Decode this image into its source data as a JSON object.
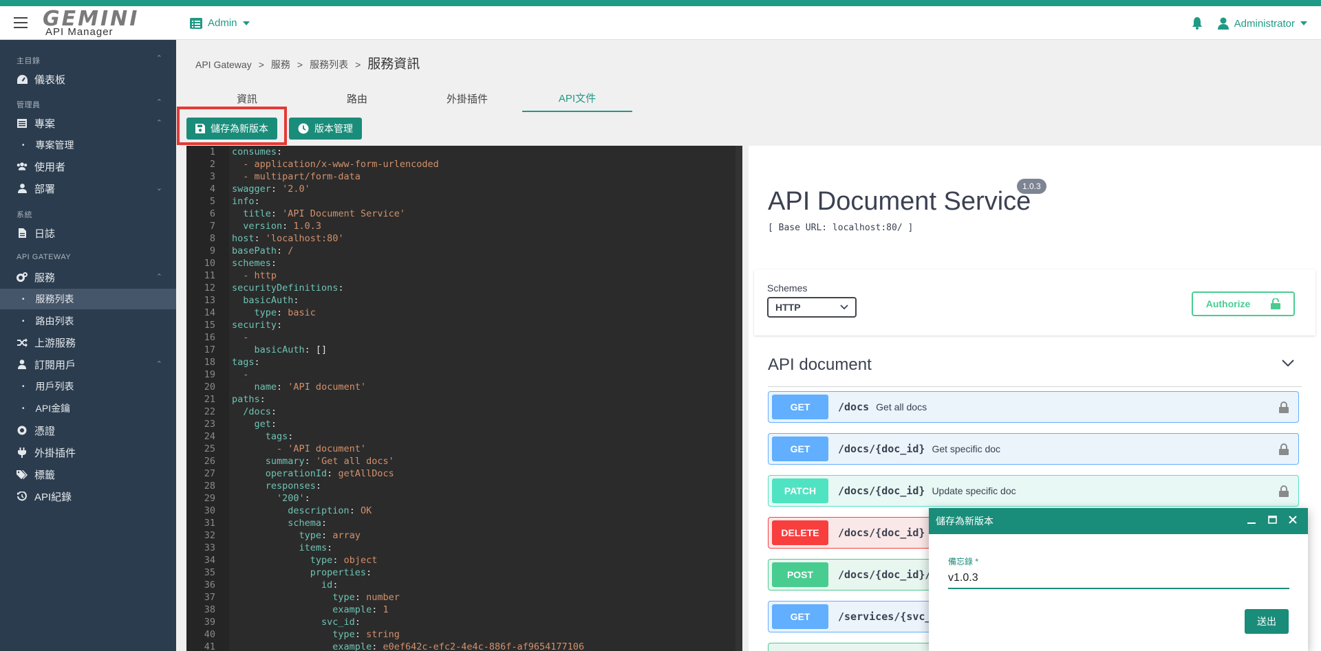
{
  "app": {
    "logo_main": "GEMINI",
    "logo_sub": "API Manager",
    "role_menu": "Admin",
    "user_name": "Administrator"
  },
  "sidebar": {
    "sections": {
      "main": "主目錄",
      "admin": "管理員",
      "system": "系統",
      "gateway": "API GATEWAY"
    },
    "items": {
      "dashboard": "儀表板",
      "projects": "專案",
      "project_mgmt": "專案管理",
      "users": "使用者",
      "departments": "部署",
      "logs": "日誌",
      "services": "服務",
      "service_list": "服務列表",
      "route_list": "路由列表",
      "upstream": "上游服務",
      "subscribers": "訂閱用戶",
      "user_list": "用戶列表",
      "api_keys": "API金鑰",
      "certs": "憑證",
      "plugins": "外掛插件",
      "tags": "標籤",
      "api_records": "API紀錄"
    }
  },
  "breadcrumb": {
    "root": "API Gateway",
    "sep": ">",
    "level1": "服務",
    "level2": "服務列表",
    "current": "服務資訊"
  },
  "tabs": [
    "資訊",
    "路由",
    "外掛插件",
    "API文件"
  ],
  "toolbar": {
    "save_new_version": "儲存為新版本",
    "version_mgmt": "版本管理"
  },
  "editor": {
    "lines": [
      [
        {
          "t": "consumes",
          "c": "k"
        },
        {
          "t": ":",
          "c": "p"
        }
      ],
      [
        {
          "t": "  - application/x-www-form-urlencoded",
          "c": "s"
        }
      ],
      [
        {
          "t": "  - multipart/form-data",
          "c": "s"
        }
      ],
      [
        {
          "t": "swagger",
          "c": "k"
        },
        {
          "t": ": ",
          "c": "p"
        },
        {
          "t": "'2.0'",
          "c": "s"
        }
      ],
      [
        {
          "t": "info",
          "c": "k"
        },
        {
          "t": ":",
          "c": "p"
        }
      ],
      [
        {
          "t": "  title",
          "c": "k"
        },
        {
          "t": ": ",
          "c": "p"
        },
        {
          "t": "'API Document Service'",
          "c": "s"
        }
      ],
      [
        {
          "t": "  version",
          "c": "k"
        },
        {
          "t": ": ",
          "c": "p"
        },
        {
          "t": "1.0.3",
          "c": "s"
        }
      ],
      [
        {
          "t": "host",
          "c": "k"
        },
        {
          "t": ": ",
          "c": "p"
        },
        {
          "t": "'localhost:80'",
          "c": "s"
        }
      ],
      [
        {
          "t": "basePath",
          "c": "k"
        },
        {
          "t": ": ",
          "c": "p"
        },
        {
          "t": "/",
          "c": "s"
        }
      ],
      [
        {
          "t": "schemes",
          "c": "k"
        },
        {
          "t": ":",
          "c": "p"
        }
      ],
      [
        {
          "t": "  - http",
          "c": "s"
        }
      ],
      [
        {
          "t": "securityDefinitions",
          "c": "k"
        },
        {
          "t": ":",
          "c": "p"
        }
      ],
      [
        {
          "t": "  basicAuth",
          "c": "k"
        },
        {
          "t": ":",
          "c": "p"
        }
      ],
      [
        {
          "t": "    type",
          "c": "k"
        },
        {
          "t": ": ",
          "c": "p"
        },
        {
          "t": "basic",
          "c": "s"
        }
      ],
      [
        {
          "t": "security",
          "c": "k"
        },
        {
          "t": ":",
          "c": "p"
        }
      ],
      [
        {
          "t": "  -",
          "c": "s"
        }
      ],
      [
        {
          "t": "    basicAuth",
          "c": "k"
        },
        {
          "t": ": []",
          "c": "p"
        }
      ],
      [
        {
          "t": "tags",
          "c": "k"
        },
        {
          "t": ":",
          "c": "p"
        }
      ],
      [
        {
          "t": "  -",
          "c": "s"
        }
      ],
      [
        {
          "t": "    name",
          "c": "k"
        },
        {
          "t": ": ",
          "c": "p"
        },
        {
          "t": "'API document'",
          "c": "s"
        }
      ],
      [
        {
          "t": "paths",
          "c": "k"
        },
        {
          "t": ":",
          "c": "p"
        }
      ],
      [
        {
          "t": "  /docs",
          "c": "k"
        },
        {
          "t": ":",
          "c": "p"
        }
      ],
      [
        {
          "t": "    get",
          "c": "k"
        },
        {
          "t": ":",
          "c": "p"
        }
      ],
      [
        {
          "t": "      tags",
          "c": "k"
        },
        {
          "t": ":",
          "c": "p"
        }
      ],
      [
        {
          "t": "        - 'API document'",
          "c": "s"
        }
      ],
      [
        {
          "t": "      summary",
          "c": "k"
        },
        {
          "t": ": ",
          "c": "p"
        },
        {
          "t": "'Get all docs'",
          "c": "s"
        }
      ],
      [
        {
          "t": "      operationId",
          "c": "k"
        },
        {
          "t": ": ",
          "c": "p"
        },
        {
          "t": "getAllDocs",
          "c": "s"
        }
      ],
      [
        {
          "t": "      responses",
          "c": "k"
        },
        {
          "t": ":",
          "c": "p"
        }
      ],
      [
        {
          "t": "        '200'",
          "c": "k"
        },
        {
          "t": ":",
          "c": "p"
        }
      ],
      [
        {
          "t": "          description",
          "c": "k"
        },
        {
          "t": ": ",
          "c": "p"
        },
        {
          "t": "OK",
          "c": "s"
        }
      ],
      [
        {
          "t": "          schema",
          "c": "k"
        },
        {
          "t": ":",
          "c": "p"
        }
      ],
      [
        {
          "t": "            type",
          "c": "k"
        },
        {
          "t": ": ",
          "c": "p"
        },
        {
          "t": "array",
          "c": "s"
        }
      ],
      [
        {
          "t": "            items",
          "c": "k"
        },
        {
          "t": ":",
          "c": "p"
        }
      ],
      [
        {
          "t": "              type",
          "c": "k"
        },
        {
          "t": ": ",
          "c": "p"
        },
        {
          "t": "object",
          "c": "s"
        }
      ],
      [
        {
          "t": "              properties",
          "c": "k"
        },
        {
          "t": ":",
          "c": "p"
        }
      ],
      [
        {
          "t": "                id",
          "c": "k"
        },
        {
          "t": ":",
          "c": "p"
        }
      ],
      [
        {
          "t": "                  type",
          "c": "k"
        },
        {
          "t": ": ",
          "c": "p"
        },
        {
          "t": "number",
          "c": "s"
        }
      ],
      [
        {
          "t": "                  example",
          "c": "k"
        },
        {
          "t": ": ",
          "c": "p"
        },
        {
          "t": "1",
          "c": "s"
        }
      ],
      [
        {
          "t": "                svc_id",
          "c": "k"
        },
        {
          "t": ":",
          "c": "p"
        }
      ],
      [
        {
          "t": "                  type",
          "c": "k"
        },
        {
          "t": ": ",
          "c": "p"
        },
        {
          "t": "string",
          "c": "s"
        }
      ],
      [
        {
          "t": "                  example",
          "c": "k"
        },
        {
          "t": ": ",
          "c": "p"
        },
        {
          "t": "e0ef642c-efc2-4e4c-886f-af9654177106",
          "c": "s"
        }
      ]
    ]
  },
  "swagger": {
    "title": "API Document Service",
    "version": "1.0.3",
    "base_url": "[ Base URL: localhost:80/ ]",
    "schemes_label": "Schemes",
    "schemes_value": "HTTP",
    "authorize": "Authorize",
    "tag_name": "API document",
    "operations": [
      {
        "method": "GET",
        "path": "/docs",
        "summary": "Get all docs",
        "kind": "get"
      },
      {
        "method": "GET",
        "path": "/docs/{doc_id}",
        "summary": "Get specific doc",
        "kind": "get"
      },
      {
        "method": "PATCH",
        "path": "/docs/{doc_id}",
        "summary": "Update specific doc",
        "kind": "patch"
      },
      {
        "method": "DELETE",
        "path": "/docs/{doc_id}",
        "summary": "",
        "kind": "delete"
      },
      {
        "method": "POST",
        "path": "/docs/{doc_id}/",
        "summary": "",
        "kind": "post"
      },
      {
        "method": "GET",
        "path": "/services/{svc_",
        "summary": "",
        "kind": "get"
      }
    ]
  },
  "dialog": {
    "title": "儲存為新版本",
    "field_label": "備忘錄 *",
    "field_value": "v1.0.3",
    "submit": "送出"
  },
  "colors": {
    "brand": "#1f9a86",
    "sidebar_bg": "#2b3c4e",
    "get": "#61affe",
    "patch": "#50e3c2",
    "delete": "#f93e3e",
    "post": "#49cc90",
    "highlight": "#e53935"
  }
}
